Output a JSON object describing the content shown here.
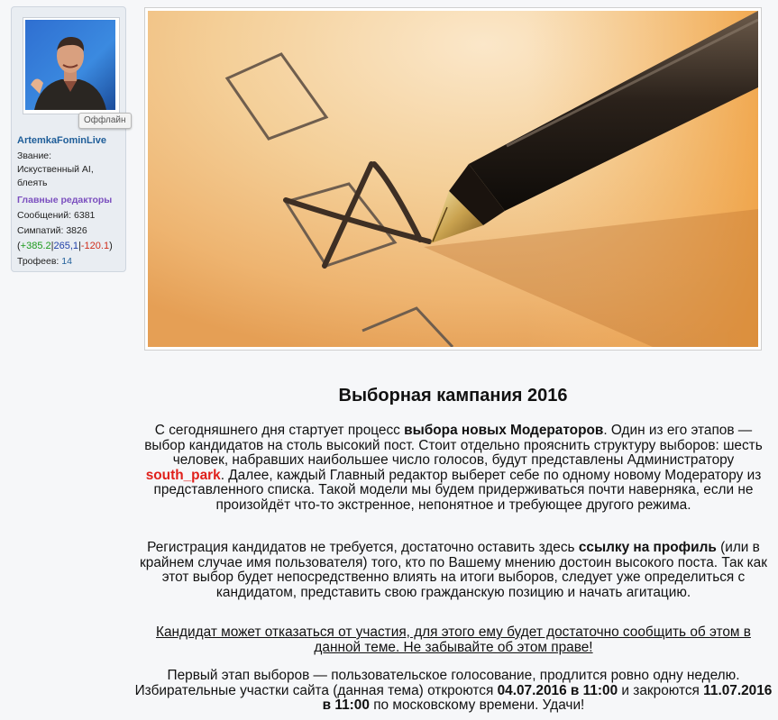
{
  "user": {
    "name": "ArtemkaFominLive",
    "status_badge": "Оффлайн",
    "title_label": "Звание:",
    "title_value": "Искуственный AI, блеять",
    "group": "Главные редакторы",
    "posts_label": "Сообщений:",
    "posts": "6381",
    "likes_label": "Симпатий:",
    "likes": "3826",
    "rep_pos": "+385.2",
    "rep_mid": "265,1",
    "rep_neg": "-120.1",
    "trophies_label": "Трофеев:",
    "trophies": "14"
  },
  "post": {
    "title": "Выборная кампания 2016",
    "p1": {
      "t1": "С сегодняшнего дня стартует процесс ",
      "b1": "выбора новых Модераторов",
      "t2": ". Один из его этапов — выбор кандидатов на столь высокий пост. Стоит отдельно прояснить структуру выборов: шесть человек, набравших наибольшее число голосов, будут представлены Администратору ",
      "admin": "south_park",
      "t3": ". Далее, каждый Главный редактор выберет себе по одному новому Модератору из представленного списка. Такой модели мы будем придерживаться почти наверняка, если не произойдёт что-то экстренное, непонятное и требующее другого режима."
    },
    "p2": {
      "t1": "Регистрация кандидатов не требуется, достаточно оставить здесь ",
      "b1": "ссылку на профиль",
      "t2": " (или в крайнем случае имя пользователя) того, кто по Вашему мнению достоин высокого поста. Так как этот выбор будет непосредственно влиять на итоги выборов, следует уже определиться с кандидатом, представить свою гражданскую позицию и начать агитацию."
    },
    "p3": "Кандидат может отказаться от участия, для этого ему будет достаточно сообщить об этом в данной теме. Не забывайте об этом праве!",
    "p4": {
      "t1": "Первый этап выборов — пользовательское голосование, продлится ровно одну неделю. Избирательные участки сайта (данная тема) откроются ",
      "d1": "04.07.2016 в 11:00",
      "t2": " и закроются ",
      "d2": "11.07.2016 в 11:00",
      "t3": " по московскому времени. Удачи!"
    }
  },
  "colors": {
    "username": "#1f5e99",
    "group": "#7b4fbf",
    "rep_pos": "#1c9a1c",
    "rep_mid": "#1f3fa8",
    "rep_neg": "#d02d1b",
    "admin_link": "#e0201b"
  }
}
